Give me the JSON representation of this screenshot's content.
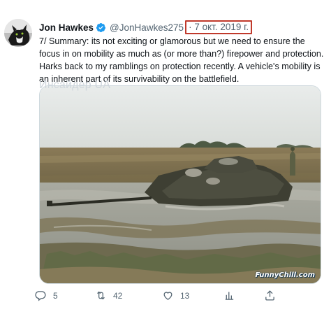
{
  "tweet": {
    "author_name": "Jon Hawkes",
    "handle": "@JonHawkes275",
    "separator": "·",
    "date": "7 окт. 2019 г.",
    "text": "7/ Summary: its not exciting or glamorous but we need to ensure the focus in on mobility as much as (or more than?) firepower and protection. Harks back to my ramblings on protection recently. A vehicle's mobility is an inherent part of its survivability on the battlefield.",
    "watermark": "Инсайдер UA",
    "media_credit": "FunnyChill.com",
    "media_description_icon": "tank-stuck-in-mud-photo"
  },
  "actions": {
    "reply": {
      "icon": "reply-icon",
      "count": "5"
    },
    "retweet": {
      "icon": "retweet-icon",
      "count": "42"
    },
    "like": {
      "icon": "heart-icon",
      "count": "13"
    },
    "views": {
      "icon": "analytics-icon"
    },
    "share": {
      "icon": "share-icon"
    }
  },
  "colors": {
    "text": "#0f1419",
    "secondary": "#536471",
    "verified": "#1d9bf0",
    "highlight_box": "#c0392b"
  }
}
